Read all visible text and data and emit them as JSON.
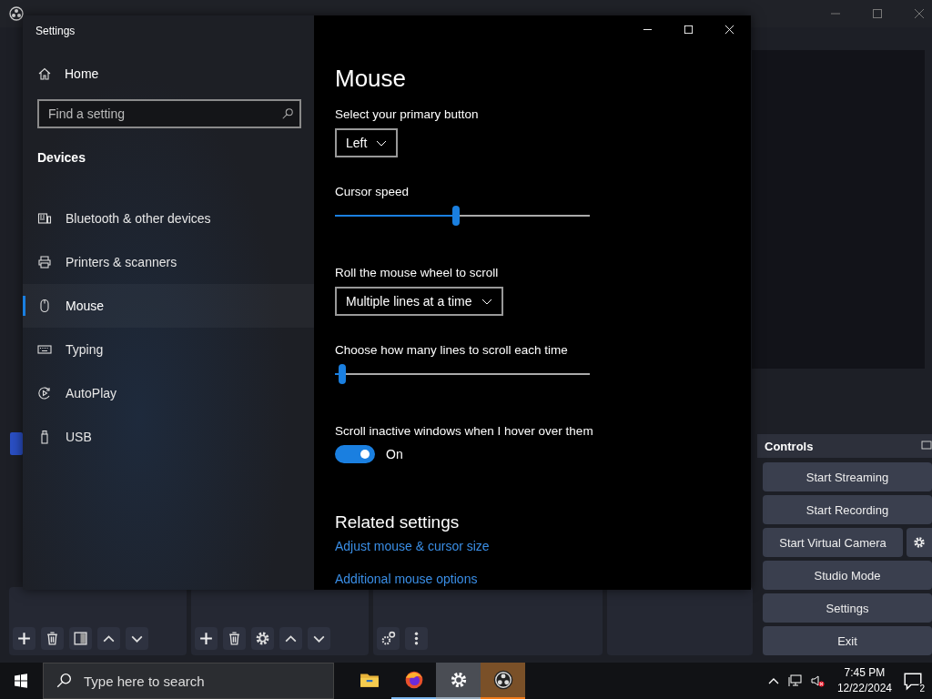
{
  "settings": {
    "title": "Settings",
    "home": "Home",
    "search": {
      "placeholder": "Find a setting"
    },
    "section": "Devices",
    "nav": [
      {
        "kind": "devices",
        "label": "Bluetooth & other devices",
        "selected": false
      },
      {
        "kind": "printer",
        "label": "Printers & scanners",
        "selected": false
      },
      {
        "kind": "mouse",
        "label": "Mouse",
        "selected": true
      },
      {
        "kind": "keyboard",
        "label": "Typing",
        "selected": false
      },
      {
        "kind": "autoplay",
        "label": "AutoPlay",
        "selected": false
      },
      {
        "kind": "usb",
        "label": "USB",
        "selected": false
      }
    ],
    "page": {
      "title": "Mouse",
      "primary_button": {
        "label": "Select your primary button",
        "value": "Left"
      },
      "cursor_speed": {
        "label": "Cursor speed",
        "level": 0.475
      },
      "wheel": {
        "label": "Roll the mouse wheel to scroll",
        "value": "Multiple lines at a time"
      },
      "lines": {
        "label": "Choose how many lines to scroll each time",
        "level": 0.03
      },
      "inactive": {
        "label": "Scroll inactive windows when I hover over them",
        "on": true,
        "state_text": "On"
      },
      "related": {
        "title": "Related settings",
        "links": [
          "Adjust mouse & cursor size",
          "Additional mouse options"
        ]
      }
    }
  },
  "controls": {
    "title": "Controls",
    "buttons": [
      {
        "kind": "plain",
        "label": "Start Streaming"
      },
      {
        "kind": "plain",
        "label": "Start Recording"
      },
      {
        "kind": "with_gear",
        "label": "Start Virtual Camera"
      },
      {
        "kind": "plain",
        "label": "Studio Mode"
      },
      {
        "kind": "plain",
        "label": "Settings"
      },
      {
        "kind": "plain",
        "label": "Exit"
      }
    ]
  },
  "taskbar": {
    "search": {
      "placeholder": "Type here to search"
    },
    "apps": [
      {
        "kind": "folder",
        "selected": false
      },
      {
        "kind": "browser",
        "selected": false
      },
      {
        "kind": "gear",
        "selected": true
      },
      {
        "kind": "obs",
        "selected": false
      }
    ],
    "time": "7:45 PM",
    "date": "12/22/2024",
    "notifications": "2"
  }
}
